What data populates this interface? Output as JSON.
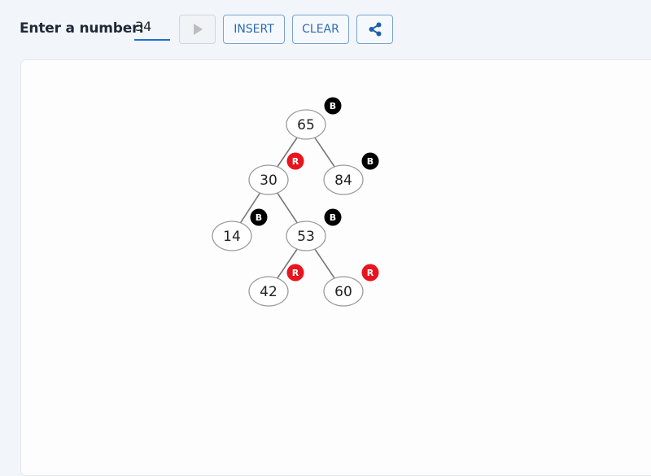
{
  "toolbar": {
    "label": "Enter a number:",
    "input_value": "34",
    "insert_label": "INSERT",
    "clear_label": "CLEAR",
    "play_icon": "play-icon",
    "share_icon": "share-icon"
  },
  "colors": {
    "accent": "#1e6fd6",
    "black_badge": "#000000",
    "red_badge": "#e8141e",
    "edge": "#777777"
  },
  "tree": {
    "nodes": [
      {
        "id": "65",
        "label": "65",
        "color": "B",
        "parent": null
      },
      {
        "id": "30",
        "label": "30",
        "color": "R",
        "parent": "65"
      },
      {
        "id": "84",
        "label": "84",
        "color": "B",
        "parent": "65"
      },
      {
        "id": "14",
        "label": "14",
        "color": "B",
        "parent": "30"
      },
      {
        "id": "53",
        "label": "53",
        "color": "B",
        "parent": "30"
      },
      {
        "id": "42",
        "label": "42",
        "color": "R",
        "parent": "53"
      },
      {
        "id": "60",
        "label": "60",
        "color": "R",
        "parent": "53"
      }
    ]
  }
}
